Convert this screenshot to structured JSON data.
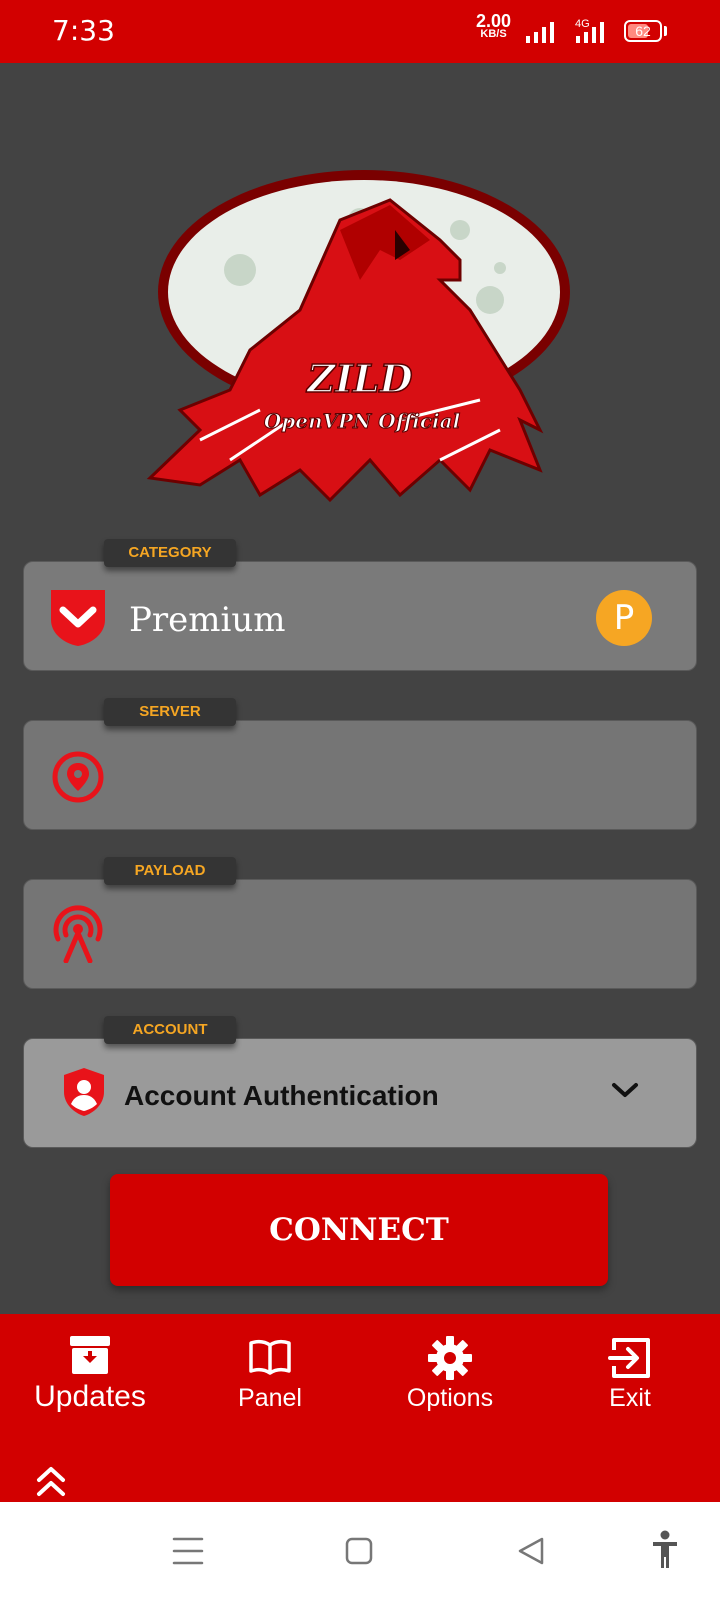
{
  "status_bar": {
    "time": "7:33",
    "net_speed_value": "2.00",
    "net_speed_unit": "KB/S",
    "network_type": "4G",
    "battery_level": "62"
  },
  "logo": {
    "text_line1": "ZILD",
    "text_line2": "OpenVPN Official"
  },
  "form": {
    "category": {
      "chip_label": "CATEGORY",
      "value": "Premium",
      "badge": "P",
      "icon": "shield-chevron-icon"
    },
    "server": {
      "chip_label": "SERVER",
      "value": "",
      "icon": "location-pin-icon"
    },
    "payload": {
      "chip_label": "PAYLOAD",
      "value": "",
      "icon": "broadcast-antenna-icon"
    },
    "account": {
      "chip_label": "ACCOUNT",
      "value": "Account Authentication",
      "icon": "user-shield-icon"
    }
  },
  "connect_button": {
    "label": "CONNECT"
  },
  "bottom_nav": {
    "items": [
      {
        "label": "Updates",
        "icon": "archive-download-icon"
      },
      {
        "label": "Panel",
        "icon": "book-open-icon"
      },
      {
        "label": "Options",
        "icon": "gear-icon"
      },
      {
        "label": "Exit",
        "icon": "exit-icon"
      }
    ]
  },
  "colors": {
    "accent_red": "#d20000",
    "background": "#434343",
    "chip_text": "#f5a623",
    "badge": "#f6a623"
  }
}
